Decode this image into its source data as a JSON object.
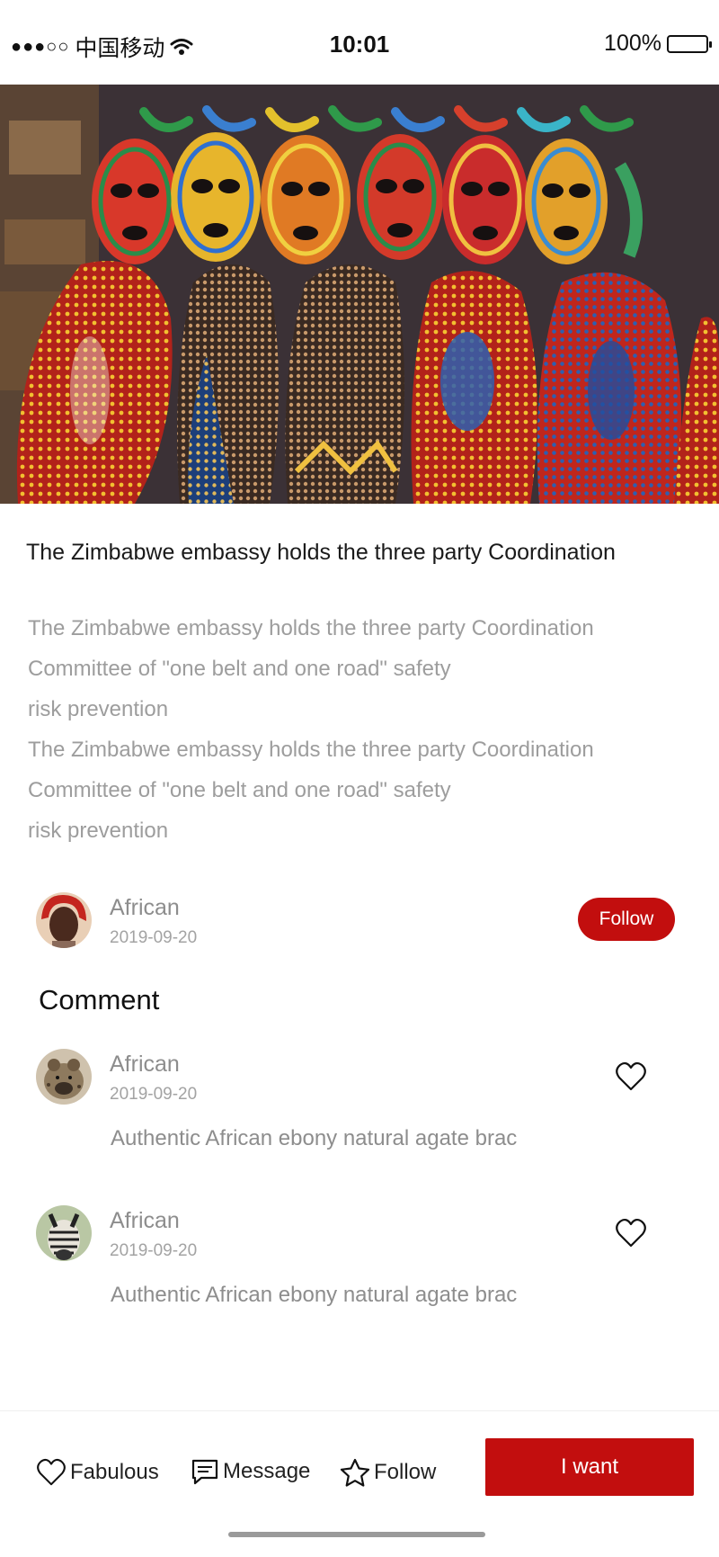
{
  "status_bar": {
    "signal": "●●●○○",
    "carrier": "中国移动",
    "time": "10:01",
    "battery_text": "100%",
    "battery_level": 1.0
  },
  "hero": {
    "icon": "masks-photo"
  },
  "article": {
    "title": "The Zimbabwe embassy holds the three party Coordination",
    "lines": [
      "The Zimbabwe embassy holds the three party Coordination",
      "Committee of \"one belt and one road\" safety",
      "risk prevention",
      "The Zimbabwe embassy holds the three party Coordination",
      "Committee of \"one belt and one road\" safety",
      "risk prevention"
    ]
  },
  "author": {
    "name": "African",
    "date": "2019-09-20",
    "follow_label": "Follow"
  },
  "comments": {
    "heading": "Comment",
    "items": [
      {
        "name": "African",
        "date": "2019-09-20",
        "text": "Authentic African ebony natural agate brac"
      },
      {
        "name": "African",
        "date": "2019-09-20",
        "text": "Authentic African ebony natural agate brac"
      }
    ]
  },
  "bottom_bar": {
    "fabulous_label": "Fabulous",
    "message_label": "Message",
    "follow_label": "Follow",
    "want_label": "I want"
  },
  "colors": {
    "accent": "#c20e0e",
    "muted_text": "#9d9d9d"
  }
}
